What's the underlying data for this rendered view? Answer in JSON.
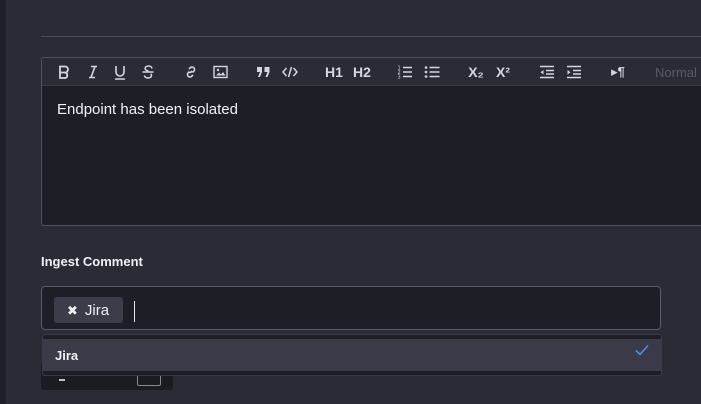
{
  "editor": {
    "toolbar": {
      "heading_value": "Normal",
      "h1_label": "H1",
      "h2_label": "H2",
      "subscript_label": "X₂",
      "superscript_label": "X²",
      "paragraph_label": "▸¶"
    },
    "content": "Endpoint has been isolated"
  },
  "ingest_comment": {
    "label": "Ingest Comment",
    "tags": [
      {
        "label": "Jira"
      }
    ],
    "dropdown": {
      "options": [
        {
          "label": "Jira",
          "selected": true
        }
      ]
    }
  },
  "colors": {
    "background": "#2b2b36",
    "panel": "#1e1e26",
    "chip": "#3c3c4a",
    "highlight_option": "#3a3a48",
    "check_accent": "#4d8fe8"
  }
}
